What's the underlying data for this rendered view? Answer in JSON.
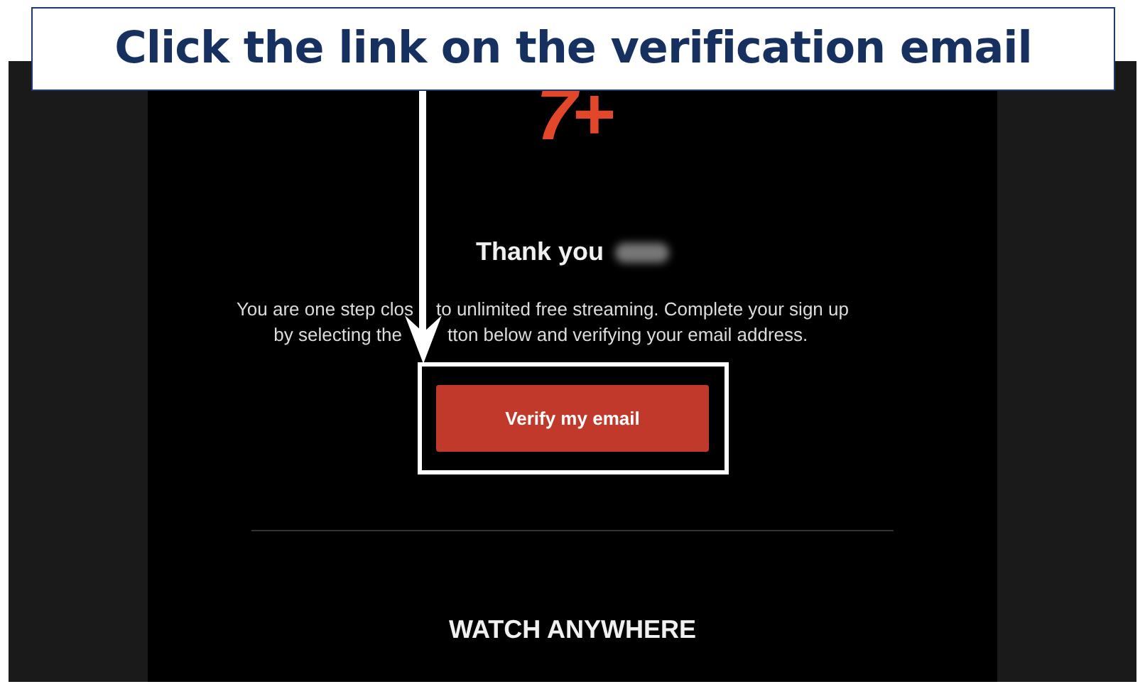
{
  "callout": {
    "title": "Click the link on the verification email"
  },
  "email": {
    "logo": "7+",
    "greeting": "Thank you",
    "body_lines": [
      [
        "You are one step clos",
        "to unlimited free streaming. Complete your sign up"
      ],
      [
        "by selecting the",
        "tton below and verifying your email address."
      ]
    ],
    "button": "Verify my email",
    "section_heading": "WATCH ANYWHERE"
  }
}
